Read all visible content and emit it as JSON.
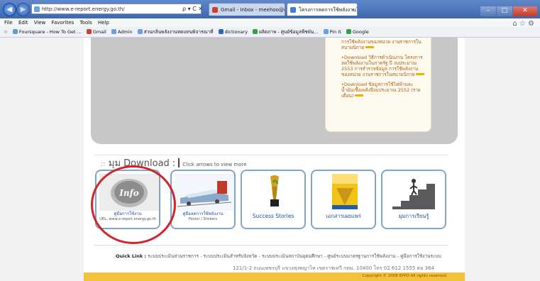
{
  "browser": {
    "address_url": "http://www.e-report.energy.go.th/",
    "address_controls": "ρ ▾ C ✕",
    "tabs": [
      {
        "label": "Gmail - Inbox - meehoo@gmail...",
        "color": "#d13f2c"
      },
      {
        "label": "โครงการลดการใช้พลังงานในภ...",
        "color": "#3c7bd6"
      }
    ],
    "tab_close": "×",
    "window_buttons": {
      "min": "–",
      "max": "□",
      "close": "✕"
    },
    "tool_icons": "⌂ ☆ ⚙",
    "menu": [
      "File",
      "Edit",
      "View",
      "Favorites",
      "Tools",
      "Help"
    ],
    "favorites": [
      {
        "label": "Foursquare - How To Get ...",
        "color": "#5aa0d0"
      },
      {
        "label": "Gmail",
        "color": "#d13f2c"
      },
      {
        "label": "Admin",
        "color": "#6aa0e0"
      },
      {
        "label": "ส่วนกลิ่นพลังงานทดแทนพิจารณาที่",
        "color": "#6aa0e0"
      },
      {
        "label": "dictionary",
        "color": "#2a6ab8"
      },
      {
        "label": "ผลิตภาพ - ศูนย์ข้อมูลพืชพัน...",
        "color": "#2fa34a"
      },
      {
        "label": "Pin It",
        "color": "#6aa0e0"
      },
      {
        "label": "Google",
        "color": "#2fa34a"
      }
    ]
  },
  "news": [
    "การใช้พลังงานของหน่วย งานราชการในสนามนิกาย",
    "•Download วิธีการดำเนินงาน โครงการลดใช้พลังงานในภาครัฐ ปี งบประมาณ 2553 การสำรวจข้อมูล การใช้พลังงานของหน่วย งานราชการในสนามนิกาย",
    "•Download ข้อมูลการใช้ไฟฟ้าและ น้ำมันเชื้อเพลิงปีงบประมาณ 2552 (รายเดือน)"
  ],
  "download": {
    "prefix": "::",
    "title": "มุม Download :",
    "hint": "Click arrows to view more",
    "items": [
      {
        "caption": "คู่มือการใช้งาน",
        "sub": "URL: www.e-report.energy.go.th"
      },
      {
        "caption": "คู่มือลดการใช้พลังงาน",
        "sub": "Poster / Stickers"
      },
      {
        "caption": "Success Stories",
        "sub": ""
      },
      {
        "caption": "เอกสารเผยแพร่",
        "sub": ""
      },
      {
        "caption": "มุมการเรียนรู้",
        "sub": ""
      }
    ],
    "logo_text": "Info"
  },
  "footer": {
    "quicklink_label": "Quick Link :",
    "quicklinks": "ระบบประเมินส่วนราชการ - ระบบประเมินสำหรับจังหวัด - ระบบประเมินสถาบันอุดมศึกษา - ศูนย์ระบบมาตรฐานการใช้พลังงาน - คู่มือการใช้งานระบบ",
    "address": "121/1-2 ถนนเพชรบุรี แขวงทุ่งพญาไท เขตราชเทวี กทม. 10400 โทร 02 612 1555 ต่อ 364",
    "copyright": "Copyright © 2008 EPPO All rights reserved"
  },
  "colors": {
    "accent_red": "#d0262b",
    "thumb_border": "#7fa5c7",
    "news_text": "#b35a0e",
    "footer_bar": "#f3c13a"
  }
}
